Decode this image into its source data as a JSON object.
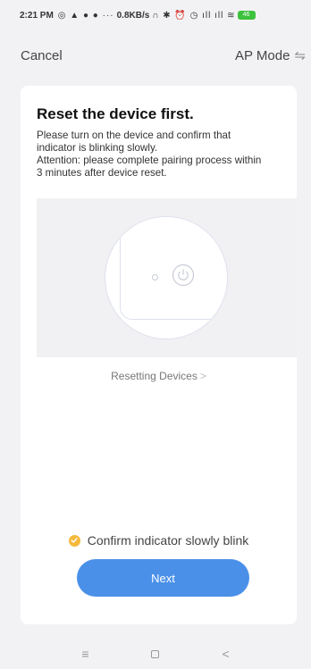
{
  "status_bar": {
    "time": "2:21 PM",
    "icons_left": "◎ ▲ ● ● ···",
    "net_speed": "0.8KB/s",
    "icons_right": "∩ ✱ ⏰ ◷ ıll ıll ≋",
    "battery": "46"
  },
  "nav": {
    "cancel_label": "Cancel",
    "ap_mode_label": "AP Mode",
    "swap_icon": "⇋"
  },
  "card": {
    "title": "Reset the device first.",
    "description_lines": [
      "Please turn on the device and confirm that",
      "indicator is blinking slowly.",
      "Attention: please complete pairing process within",
      "3 minutes after device reset."
    ],
    "reset_link_label": "Resetting Devices",
    "reset_link_chevron": ">",
    "confirm_label": "Confirm indicator slowly blink",
    "confirm_checked": true,
    "next_label": "Next"
  },
  "colors": {
    "accent": "#4a90e8",
    "check": "#f5b93b",
    "battery": "#3cc23c"
  },
  "system_nav": {
    "menu_icon": "≡",
    "back_icon": "<"
  }
}
